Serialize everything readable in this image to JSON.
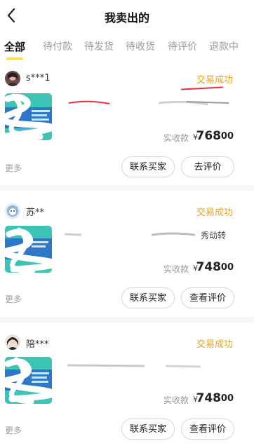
{
  "header": {
    "title": "我卖出的",
    "back_icon": "chevron-left-icon"
  },
  "tabs": [
    {
      "label": "全部",
      "active": true
    },
    {
      "label": "待付款",
      "active": false
    },
    {
      "label": "待发货",
      "active": false
    },
    {
      "label": "待收货",
      "active": false
    },
    {
      "label": "待评价",
      "active": false
    },
    {
      "label": "退款中",
      "active": false
    }
  ],
  "orders": [
    {
      "buyer": "s***1",
      "status": "交易成功",
      "item_title_visible": "",
      "price_label": "实收款",
      "currency": "¥",
      "price_int": "768",
      "price_dec": ".00",
      "more": "更多",
      "buttons": [
        "联系买家",
        "去评价"
      ]
    },
    {
      "buyer": "苏**",
      "status": "交易成功",
      "item_title_visible": "秀动转",
      "price_label": "实收款",
      "currency": "¥",
      "price_int": "748",
      "price_dec": ".00",
      "more": "更多",
      "buttons": [
        "联系买家",
        "查看评价"
      ]
    },
    {
      "buyer": "陪***",
      "status": "交易成功",
      "item_title_visible": "",
      "price_label": "实收款",
      "currency": "¥",
      "price_int": "748",
      "price_dec": ".00",
      "more": "更多",
      "buttons": [
        "联系买家",
        "查看评价"
      ]
    }
  ],
  "colors": {
    "accent_yellow": "#ffd84d",
    "status_orange": "#e7a21b",
    "ticket_teal": "#3cc4b4",
    "ticket_blue": "#2e76c8"
  }
}
